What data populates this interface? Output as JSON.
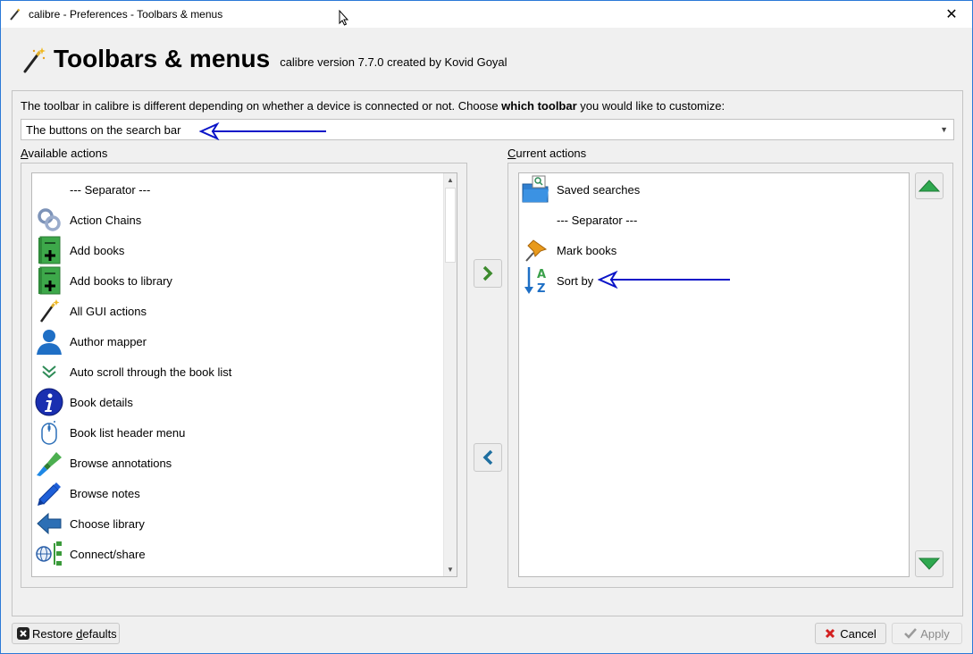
{
  "window": {
    "title": "calibre - Preferences - Toolbars & menus",
    "close_glyph": "✕"
  },
  "header": {
    "title": "Toolbars & menus",
    "version": "calibre version 7.7.0 created by Kovid Goyal"
  },
  "description": {
    "prefix": "The toolbar in calibre is different depending on whether a device is connected or not. Choose ",
    "bold": "which toolbar",
    "suffix": " you would like to customize:"
  },
  "toolbar_select": {
    "value": "The buttons on the search bar"
  },
  "available": {
    "label_access": "A",
    "label_rest": "vailable actions",
    "items": [
      {
        "label": "--- Separator ---",
        "icon": "none"
      },
      {
        "label": "Action Chains",
        "icon": "chain-icon"
      },
      {
        "label": "Add books",
        "icon": "add-book-icon"
      },
      {
        "label": "Add books to library",
        "icon": "add-book-icon"
      },
      {
        "label": "All GUI actions",
        "icon": "magic-wand-icon"
      },
      {
        "label": "Author mapper",
        "icon": "person-icon"
      },
      {
        "label": "Auto scroll through the book list",
        "icon": "double-chevron-down-icon"
      },
      {
        "label": "Book details",
        "icon": "info-icon"
      },
      {
        "label": "Book list header menu",
        "icon": "mouse-icon"
      },
      {
        "label": "Browse annotations",
        "icon": "highlighter-icon"
      },
      {
        "label": "Browse notes",
        "icon": "pencil-icon"
      },
      {
        "label": "Choose library",
        "icon": "arrow-left-icon"
      },
      {
        "label": "Connect/share",
        "icon": "network-icon"
      }
    ]
  },
  "current": {
    "label_access": "C",
    "label_rest": "urrent actions",
    "items": [
      {
        "label": "Saved searches",
        "icon": "folder-search-icon"
      },
      {
        "label": "--- Separator ---",
        "icon": "none"
      },
      {
        "label": "Mark books",
        "icon": "pin-icon"
      },
      {
        "label": "Sort by",
        "icon": "sort-az-icon"
      }
    ]
  },
  "buttons": {
    "restore_pre": "Restore ",
    "restore_access": "d",
    "restore_post": "efaults",
    "cancel": "Cancel",
    "apply": "Apply"
  },
  "colors": {
    "annotation_arrow": "#0a14c8",
    "move_up_green": "#2fa84f",
    "add_arrow_green": "#3d8a2e",
    "remove_arrow_blue": "#1e6fa0",
    "apply_disabled": "#8c8c8c"
  }
}
